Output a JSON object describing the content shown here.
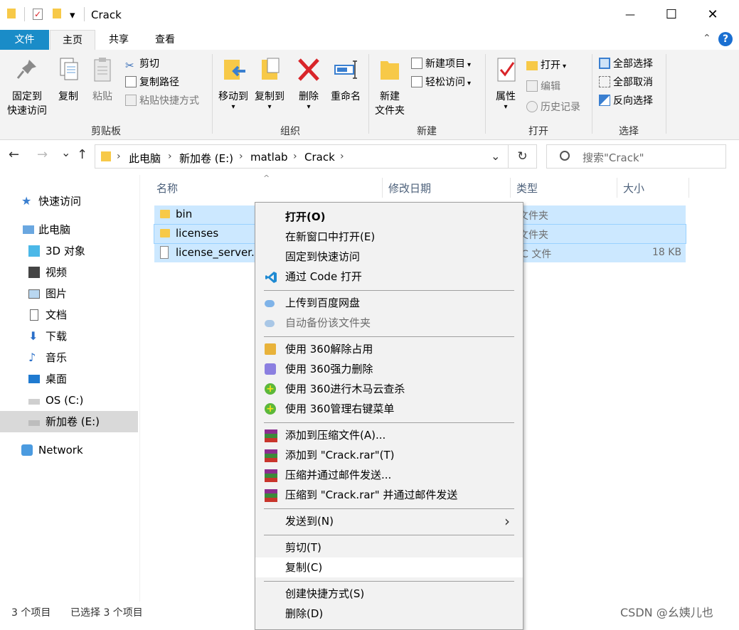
{
  "window": {
    "title": "Crack",
    "minimize": "—",
    "maximize": "☐",
    "close": "✕",
    "qat_dropdown": "▾"
  },
  "tabs": {
    "file": "文件",
    "home": "主页",
    "share": "共享",
    "view": "查看",
    "collapse": "⌃",
    "help": "?"
  },
  "ribbon": {
    "clipboard": {
      "label": "剪贴板",
      "pin_line1": "固定到",
      "pin_line2": "快速访问",
      "copy": "复制",
      "paste": "粘贴",
      "cut": "剪切",
      "copy_path": "复制路径",
      "paste_shortcut": "粘贴快捷方式"
    },
    "organize": {
      "label": "组织",
      "move_to": "移动到",
      "copy_to": "复制到",
      "delete": "删除",
      "rename": "重命名"
    },
    "new": {
      "label": "新建",
      "new_folder_line1": "新建",
      "new_folder_line2": "文件夹",
      "new_item": "新建项目",
      "easy_access": "轻松访问"
    },
    "open": {
      "label": "打开",
      "properties": "属性",
      "open": "打开",
      "edit": "编辑",
      "history": "历史记录"
    },
    "select": {
      "label": "选择",
      "select_all": "全部选择",
      "select_none": "全部取消",
      "invert": "反向选择"
    }
  },
  "address": {
    "back": "←",
    "forward": "→",
    "recent": "⌄",
    "up": "↑",
    "crumbs": [
      "此电脑",
      "新加卷 (E:)",
      "matlab",
      "Crack"
    ],
    "chevron": "›",
    "dropdown": "⌄",
    "refresh": "↻",
    "search_placeholder": "搜索\"Crack\""
  },
  "sidebar": {
    "items": [
      {
        "label": "快速访问"
      },
      {
        "label": "此电脑"
      },
      {
        "label": "3D 对象"
      },
      {
        "label": "视频"
      },
      {
        "label": "图片"
      },
      {
        "label": "文档"
      },
      {
        "label": "下载"
      },
      {
        "label": "音乐"
      },
      {
        "label": "桌面"
      },
      {
        "label": "OS (C:)"
      },
      {
        "label": "新加卷 (E:)"
      },
      {
        "label": "Network"
      }
    ]
  },
  "columns": {
    "name": "名称",
    "date": "修改日期",
    "type": "类型",
    "size": "大小",
    "sort": "^"
  },
  "files": [
    {
      "name": "bin",
      "type": "文件夹",
      "size": ""
    },
    {
      "name": "licenses",
      "type": "文件夹",
      "size": ""
    },
    {
      "name": "license_server.l",
      "type": "IC 文件",
      "size": "18 KB"
    }
  ],
  "context_menu": {
    "open": "打开(O)",
    "open_new_window": "在新窗口中打开(E)",
    "pin_quick": "固定到快速访问",
    "open_code": "通过 Code 打开",
    "upload_baidu": "上传到百度网盘",
    "auto_backup": "自动备份该文件夹",
    "360_unlock": "使用 360解除占用",
    "360_delete": "使用 360强力删除",
    "360_scan": "使用 360进行木马云查杀",
    "360_menu": "使用 360管理右键菜单",
    "add_archive": "添加到压缩文件(A)...",
    "add_crack_rar": "添加到 \"Crack.rar\"(T)",
    "compress_email": "压缩并通过邮件发送...",
    "compress_crack_email": "压缩到 \"Crack.rar\" 并通过邮件发送",
    "send_to": "发送到(N)",
    "send_to_arrow": "›",
    "cut": "剪切(T)",
    "copy": "复制(C)",
    "create_shortcut": "创建快捷方式(S)",
    "delete": "删除(D)"
  },
  "status": {
    "count": "3 个项目",
    "selected": "已选择 3 个项目"
  },
  "watermark": "CSDN @幺姨儿也",
  "colors": {
    "accent": "#1a8cc8",
    "selection": "#cce8ff",
    "ribbon_bg": "#f3f3f3",
    "menu_bg": "#f2f2f2",
    "delete_red": "#d9252a"
  }
}
